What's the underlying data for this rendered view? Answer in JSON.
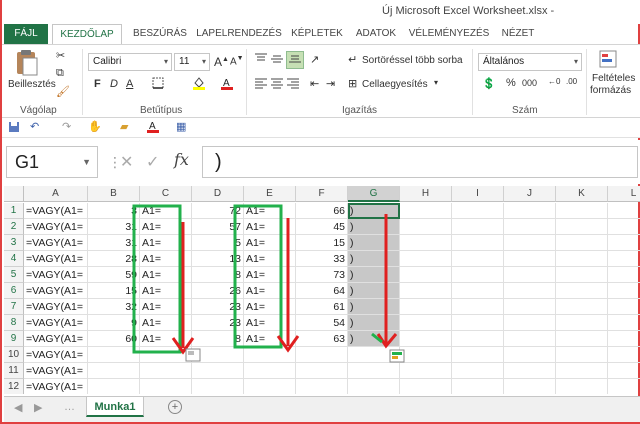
{
  "window": {
    "title": "Új Microsoft Excel Worksheet.xlsx -"
  },
  "tabs": [
    "FÁJL",
    "KEZDŐLAP",
    "BESZÚRÁS",
    "LAPELRENDEZÉS",
    "KÉPLETEK",
    "ADATOK",
    "VÉLEMÉNYEZÉS",
    "NÉZET"
  ],
  "ribbon": {
    "paste_label": "Beillesztés",
    "clipboard_label": "Vágólap",
    "font_group_label": "Betűtípus",
    "font_name": "Calibri",
    "font_size": "11",
    "bold": "F",
    "italic": "D",
    "underline": "A",
    "align_group_label": "Igazítás",
    "wrap_label": "Sortöréssel több sorba",
    "merge_label": "Cellaegyesítés",
    "number_group_label": "Szám",
    "number_format": "Általános",
    "percent": "%",
    "thousands": "000",
    "cond_format_line1": "Feltételes",
    "cond_format_line2": "formázás"
  },
  "formula_bar": {
    "name_box": "G1",
    "fx": "fx",
    "formula": ")"
  },
  "columns": [
    "A",
    "B",
    "C",
    "D",
    "E",
    "F",
    "G",
    "H",
    "I",
    "J",
    "K",
    "L"
  ],
  "rows": [
    {
      "n": "1",
      "a": "=VAGY(A1=",
      "b": "3",
      "c": "A1=",
      "d": "72",
      "e": "A1=",
      "f": "66",
      "g": ")"
    },
    {
      "n": "2",
      "a": "=VAGY(A1=",
      "b": "31",
      "c": "A1=",
      "d": "57",
      "e": "A1=",
      "f": "45",
      "g": ")"
    },
    {
      "n": "3",
      "a": "=VAGY(A1=",
      "b": "31",
      "c": "A1=",
      "d": "5",
      "e": "A1=",
      "f": "15",
      "g": ")"
    },
    {
      "n": "4",
      "a": "=VAGY(A1=",
      "b": "28",
      "c": "A1=",
      "d": "13",
      "e": "A1=",
      "f": "33",
      "g": ")"
    },
    {
      "n": "5",
      "a": "=VAGY(A1=",
      "b": "59",
      "c": "A1=",
      "d": "8",
      "e": "A1=",
      "f": "73",
      "g": ")"
    },
    {
      "n": "6",
      "a": "=VAGY(A1=",
      "b": "15",
      "c": "A1=",
      "d": "26",
      "e": "A1=",
      "f": "64",
      "g": ")"
    },
    {
      "n": "7",
      "a": "=VAGY(A1=",
      "b": "32",
      "c": "A1=",
      "d": "23",
      "e": "A1=",
      "f": "61",
      "g": ")"
    },
    {
      "n": "8",
      "a": "=VAGY(A1=",
      "b": "9",
      "c": "A1=",
      "d": "23",
      "e": "A1=",
      "f": "54",
      "g": ")"
    },
    {
      "n": "9",
      "a": "=VAGY(A1=",
      "b": "60",
      "c": "A1=",
      "d": "8",
      "e": "A1=",
      "f": "63",
      "g": ")"
    },
    {
      "n": "10",
      "a": "=VAGY(A1=",
      "b": "",
      "c": "",
      "d": "",
      "e": "",
      "f": "",
      "g": ""
    },
    {
      "n": "11",
      "a": "=VAGY(A1=",
      "b": "",
      "c": "",
      "d": "",
      "e": "",
      "f": "",
      "g": ""
    },
    {
      "n": "12",
      "a": "=VAGY(A1=",
      "b": "",
      "c": "",
      "d": "",
      "e": "",
      "f": "",
      "g": ""
    }
  ],
  "sheet": {
    "tab_label": "Munka1",
    "add_sheet": "+"
  },
  "colors": {
    "excel_green": "#217346",
    "annotation_green": "#22b14c",
    "annotation_red": "#e02020",
    "selection_gray": "#c8c8c8"
  }
}
